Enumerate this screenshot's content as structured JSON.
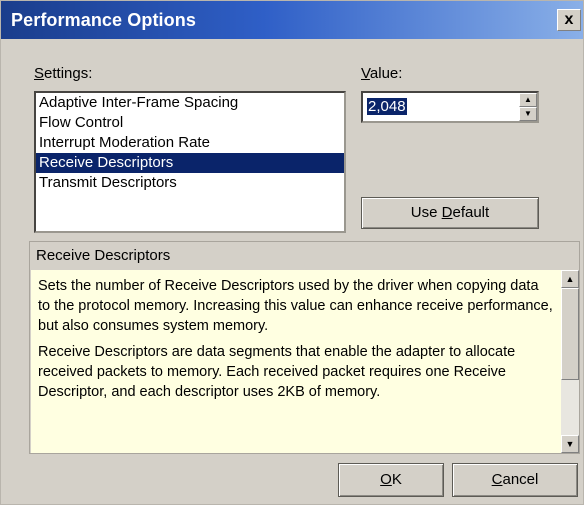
{
  "window": {
    "title": "Performance Options",
    "close_glyph": "x"
  },
  "settings": {
    "label_access": "S",
    "label_rest": "ettings:",
    "items": [
      {
        "label": "Adaptive Inter-Frame Spacing"
      },
      {
        "label": "Flow Control"
      },
      {
        "label": "Interrupt Moderation Rate"
      },
      {
        "label": "Receive Descriptors",
        "selected": true
      },
      {
        "label": "Transmit Descriptors"
      }
    ]
  },
  "value": {
    "label_access": "V",
    "label_rest": "alue:",
    "current": "2,048",
    "up_glyph": "▲",
    "down_glyph": "▼"
  },
  "use_default": {
    "prefix": "Use ",
    "access": "D",
    "rest": "efault"
  },
  "description": {
    "title": "Receive Descriptors",
    "paragraphs": [
      "Sets the number of Receive Descriptors used by the driver when copying data to the protocol memory. Increasing this value can enhance receive performance, but also consumes system memory.",
      "Receive Descriptors are data segments that enable the adapter to allocate received packets to memory. Each received packet requires one Receive Descriptor, and each descriptor uses 2KB of memory."
    ],
    "scroll_up_glyph": "▲",
    "scroll_down_glyph": "▼"
  },
  "buttons": {
    "ok": {
      "access": "O",
      "rest": "K"
    },
    "cancel": {
      "access": "C",
      "rest": "ancel"
    }
  }
}
